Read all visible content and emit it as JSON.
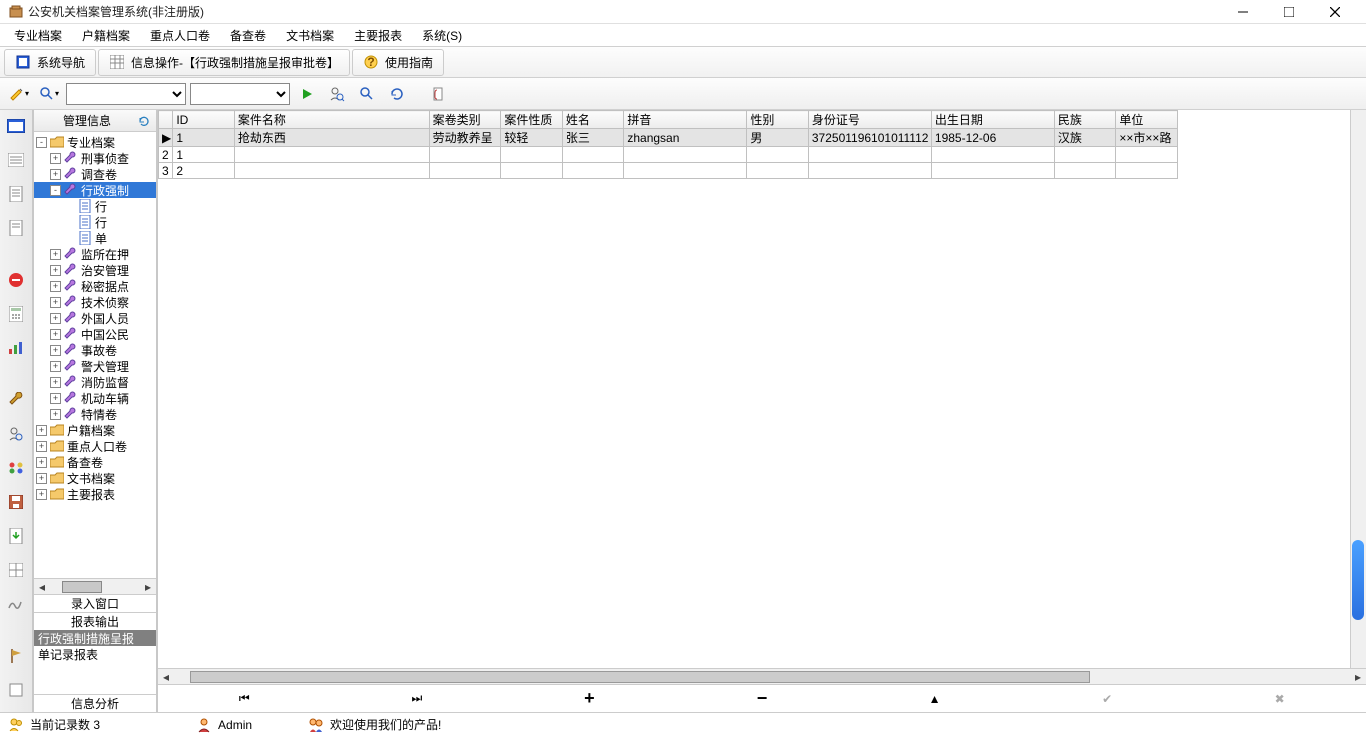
{
  "window": {
    "title": "公安机关档案管理系统(非注册版)"
  },
  "menu": {
    "items": [
      "专业档案",
      "户籍档案",
      "重点人口卷",
      "备查卷",
      "文书档案",
      "主要报表",
      "系统(S)"
    ]
  },
  "tabs": {
    "nav_label": "系统导航",
    "info_label": "信息操作-【行政强制措施呈报审批卷】",
    "guide_label": "使用指南"
  },
  "left_panel": {
    "header": "管理信息",
    "tree": {
      "root": "专业档案",
      "l1": [
        {
          "label": "刑事侦查",
          "exp": "+",
          "icon": "wrench"
        },
        {
          "label": "调查卷",
          "exp": "+",
          "icon": "wrench"
        },
        {
          "label": "行政强制",
          "exp": "-",
          "icon": "wrench",
          "selected": true,
          "children": [
            {
              "label": "行",
              "icon": "doc"
            },
            {
              "label": "行",
              "icon": "doc"
            },
            {
              "label": "单",
              "icon": "doc"
            }
          ]
        },
        {
          "label": "监所在押",
          "exp": "+",
          "icon": "wrench"
        },
        {
          "label": "治安管理",
          "exp": "+",
          "icon": "wrench"
        },
        {
          "label": "秘密据点",
          "exp": "+",
          "icon": "wrench"
        },
        {
          "label": "技术侦察",
          "exp": "+",
          "icon": "wrench"
        },
        {
          "label": "外国人员",
          "exp": "+",
          "icon": "wrench"
        },
        {
          "label": "中国公民",
          "exp": "+",
          "icon": "wrench"
        },
        {
          "label": "事故卷",
          "exp": "+",
          "icon": "wrench"
        },
        {
          "label": "警犬管理",
          "exp": "+",
          "icon": "wrench"
        },
        {
          "label": "消防监督",
          "exp": "+",
          "icon": "wrench"
        },
        {
          "label": "机动车辆",
          "exp": "+",
          "icon": "wrench"
        },
        {
          "label": "特情卷",
          "exp": "+",
          "icon": "wrench"
        }
      ],
      "siblings": [
        {
          "label": "户籍档案",
          "exp": "+",
          "icon": "folder"
        },
        {
          "label": "重点人口卷",
          "exp": "+",
          "icon": "folder"
        },
        {
          "label": "备查卷",
          "exp": "+",
          "icon": "folder"
        },
        {
          "label": "文书档案",
          "exp": "+",
          "icon": "folder"
        },
        {
          "label": "主要报表",
          "exp": "+",
          "icon": "folder"
        }
      ]
    },
    "stack": {
      "input_window": "录入窗口",
      "report_output": "报表输出",
      "items": [
        "行政强制措施呈报",
        "单记录报表"
      ],
      "info_analysis": "信息分析"
    }
  },
  "grid": {
    "columns": [
      "ID",
      "案件名称",
      "案卷类别",
      "案件性质",
      "姓名",
      "拼音",
      "性别",
      "身份证号",
      "出生日期",
      "民族",
      "单位"
    ],
    "rows": [
      {
        "n": "1",
        "ID": "1",
        "案件名称": "抢劫东西",
        "案卷类别": "劳动教养呈",
        "案件性质": "较轻",
        "姓名": "张三",
        "拼音": "zhangsan",
        "性别": "男",
        "身份证号": "372501196101011112",
        "出生日期": "1985-12-06",
        "民族": "汉族",
        "单位": "××市××路"
      },
      {
        "n": "2",
        "ID": "1"
      },
      {
        "n": "3",
        "ID": "2"
      }
    ]
  },
  "status": {
    "records": "当前记录数 3",
    "user": "Admin",
    "welcome": "欢迎使用我们的产品!"
  }
}
